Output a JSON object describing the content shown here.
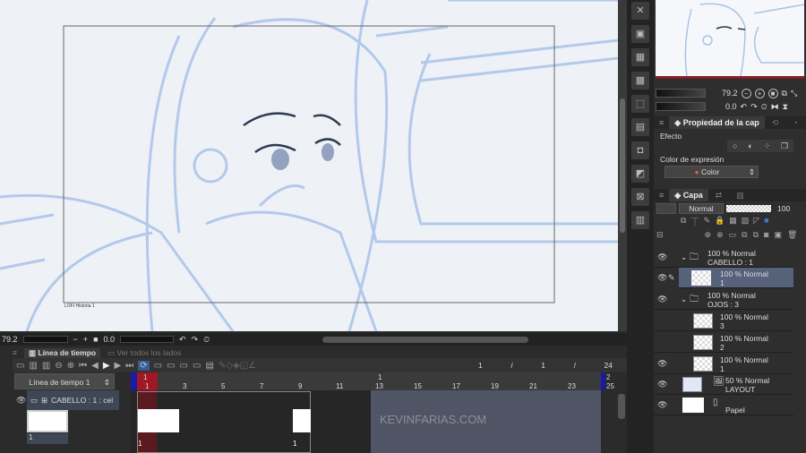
{
  "canvas": {
    "label": "LOFI Historia 1"
  },
  "navigator": {
    "zoom": "79.2",
    "rotation": "0.0"
  },
  "layer_property": {
    "tab": "Propiedad de la cap",
    "effect_label": "Efecto",
    "expression_label": "Color de expresión",
    "expression_value": "Color"
  },
  "layers_panel": {
    "tab": "Capa",
    "blend": "Normal",
    "opacity": "100",
    "layers": [
      {
        "opacity": "100 %",
        "mode": "Normal",
        "name": "CABELLO : 1",
        "type": "folder"
      },
      {
        "opacity": "100 %",
        "mode": "Normal",
        "name": "1",
        "type": "raster",
        "selected": true
      },
      {
        "opacity": "100 %",
        "mode": "Normal",
        "name": "OJOS : 3",
        "type": "folder"
      },
      {
        "opacity": "100 %",
        "mode": "Normal",
        "name": "3",
        "type": "raster"
      },
      {
        "opacity": "100 %",
        "mode": "Normal",
        "name": "2",
        "type": "raster"
      },
      {
        "opacity": "100 %",
        "mode": "Normal",
        "name": "1",
        "type": "raster"
      },
      {
        "opacity": "50 %",
        "mode": "Normal",
        "name": "LAYOUT",
        "type": "raster"
      },
      {
        "opacity": "",
        "mode": "",
        "name": "Papel",
        "type": "paper"
      }
    ]
  },
  "status": {
    "zoom": "79.2",
    "rotation": "0.0"
  },
  "timeline": {
    "tab": "Línea de tiempo",
    "tab2": "Ver todos los lados",
    "selector": "Línea de tiempo 1",
    "frame_current": "1",
    "frame_sep": "/",
    "frame_start": "1",
    "frame_sep2": "/",
    "frame_end": "24",
    "ruler": [
      "1",
      "3",
      "5",
      "7",
      "9",
      "11",
      "13",
      "15",
      "17",
      "19",
      "21",
      "23",
      "25"
    ],
    "ruler_top": {
      "1": "1",
      "13": "1",
      "25": "2"
    },
    "track": "CABELLO : 1 : cel",
    "cel_label": "1",
    "cel_a": "1",
    "cel_b": "1"
  },
  "watermark": "KEVINFARIAS.COM"
}
